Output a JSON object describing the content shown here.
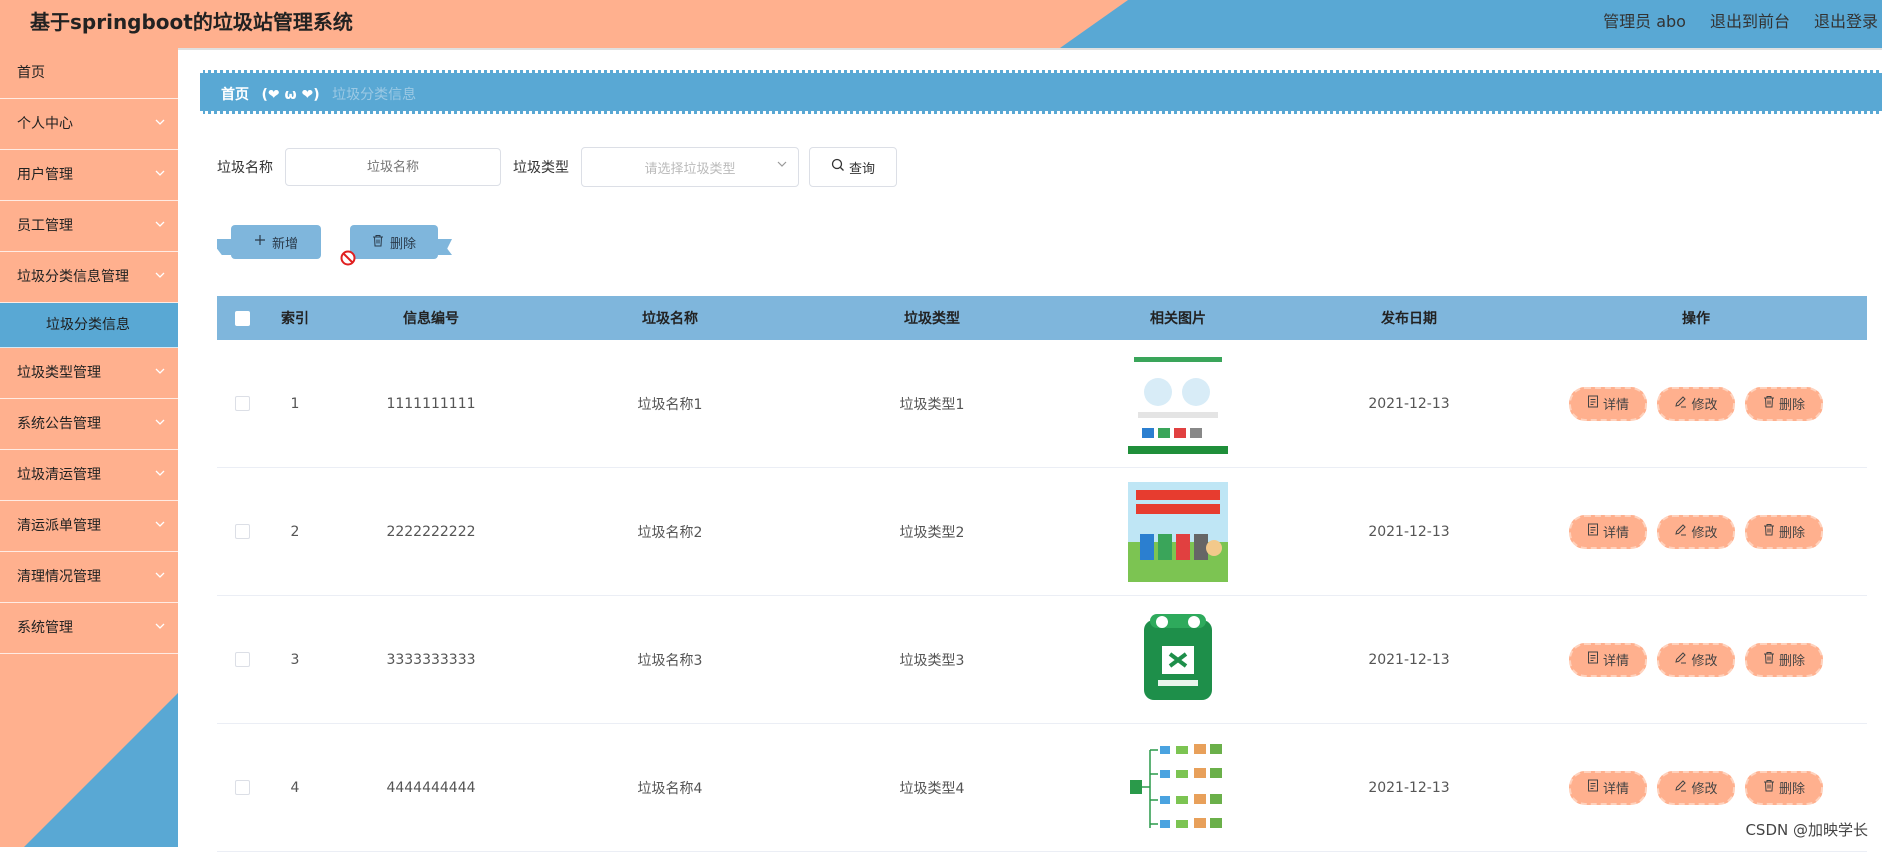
{
  "header": {
    "title": "基于springboot的垃圾站管理系统",
    "user_label": "管理员 abo",
    "front_link": "退出到前台",
    "logout_link": "退出登录"
  },
  "sidebar": {
    "items": [
      {
        "label": "首页",
        "expandable": false
      },
      {
        "label": "个人中心",
        "expandable": true
      },
      {
        "label": "用户管理",
        "expandable": true
      },
      {
        "label": "员工管理",
        "expandable": true
      },
      {
        "label": "垃圾分类信息管理",
        "expandable": true
      },
      {
        "label": "垃圾分类信息",
        "sub": true,
        "active": true
      },
      {
        "label": "垃圾类型管理",
        "expandable": true
      },
      {
        "label": "系统公告管理",
        "expandable": true
      },
      {
        "label": "垃圾清运管理",
        "expandable": true
      },
      {
        "label": "清运派单管理",
        "expandable": true
      },
      {
        "label": "清理情况管理",
        "expandable": true
      },
      {
        "label": "系统管理",
        "expandable": true
      }
    ]
  },
  "breadcrumb": {
    "home": "首页",
    "decoration": "(❤ ω ❤)",
    "current": "垃圾分类信息"
  },
  "search": {
    "name_label": "垃圾名称",
    "name_placeholder": "垃圾名称",
    "type_label": "垃圾类型",
    "type_placeholder": "请选择垃圾类型",
    "query_label": "查询"
  },
  "toolbar": {
    "add_label": "新增",
    "delete_label": "删除"
  },
  "table": {
    "columns": [
      "索引",
      "信息编号",
      "垃圾名称",
      "垃圾类型",
      "相关图片",
      "发布日期",
      "操作"
    ],
    "rows": [
      {
        "index": "1",
        "code": "1111111111",
        "name": "垃圾名称1",
        "type": "垃圾类型1",
        "image": "poster-sorting-guide",
        "date": "2021-12-13"
      },
      {
        "index": "2",
        "code": "2222222222",
        "name": "垃圾名称2",
        "type": "垃圾类型2",
        "image": "poster-cartoon-bins",
        "date": "2021-12-13"
      },
      {
        "index": "3",
        "code": "3333333333",
        "name": "垃圾名称3",
        "type": "垃圾类型3",
        "image": "green-bin-icon",
        "date": "2021-12-13"
      },
      {
        "index": "4",
        "code": "4444444444",
        "name": "垃圾名称4",
        "type": "垃圾类型4",
        "image": "sorting-flowchart",
        "date": "2021-12-13"
      }
    ],
    "actions": {
      "detail": "详情",
      "edit": "修改",
      "delete": "删除"
    }
  },
  "watermark": "CSDN @加映学长",
  "colors": {
    "peach": "#ffb08e",
    "blue": "#59a8d4",
    "table_header": "#7fb6dc"
  }
}
